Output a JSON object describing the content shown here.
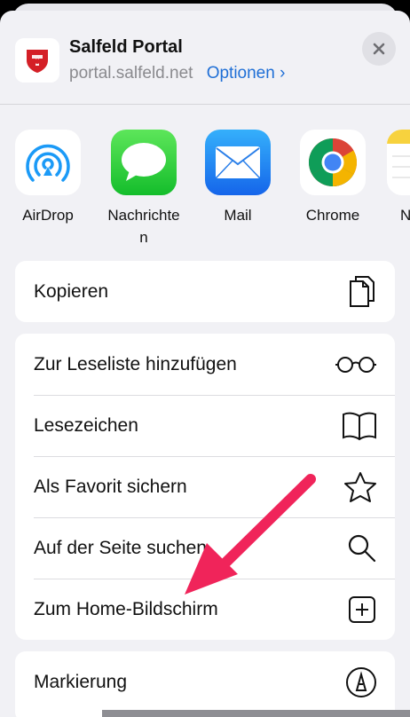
{
  "header": {
    "title": "Salfeld Portal",
    "domain": "portal.salfeld.net",
    "options_label": "Optionen ›",
    "close_icon": "close-icon"
  },
  "apps": [
    {
      "label": "AirDrop",
      "icon": "airdrop-icon"
    },
    {
      "label": "Nachrichten",
      "icon": "messages-icon"
    },
    {
      "label": "Mail",
      "icon": "mail-icon"
    },
    {
      "label": "Chrome",
      "icon": "chrome-icon"
    },
    {
      "label": "N",
      "icon": "notes-icon"
    }
  ],
  "actions_group1": [
    {
      "label": "Kopieren",
      "icon": "copy-icon"
    }
  ],
  "actions_group2": [
    {
      "label": "Zur Leseliste hinzufügen",
      "icon": "glasses-icon"
    },
    {
      "label": "Lesezeichen",
      "icon": "book-icon"
    },
    {
      "label": "Als Favorit sichern",
      "icon": "star-icon"
    },
    {
      "label": "Auf der Seite suchen",
      "icon": "search-icon"
    },
    {
      "label": "Zum Home-Bildschirm",
      "icon": "add-square-icon"
    }
  ],
  "actions_group3": [
    {
      "label": "Markierung",
      "icon": "markup-icon"
    }
  ],
  "colors": {
    "accent": "#1f6fd6",
    "annotation_arrow": "#f0245a",
    "sheet_background": "#f1f1f5"
  }
}
